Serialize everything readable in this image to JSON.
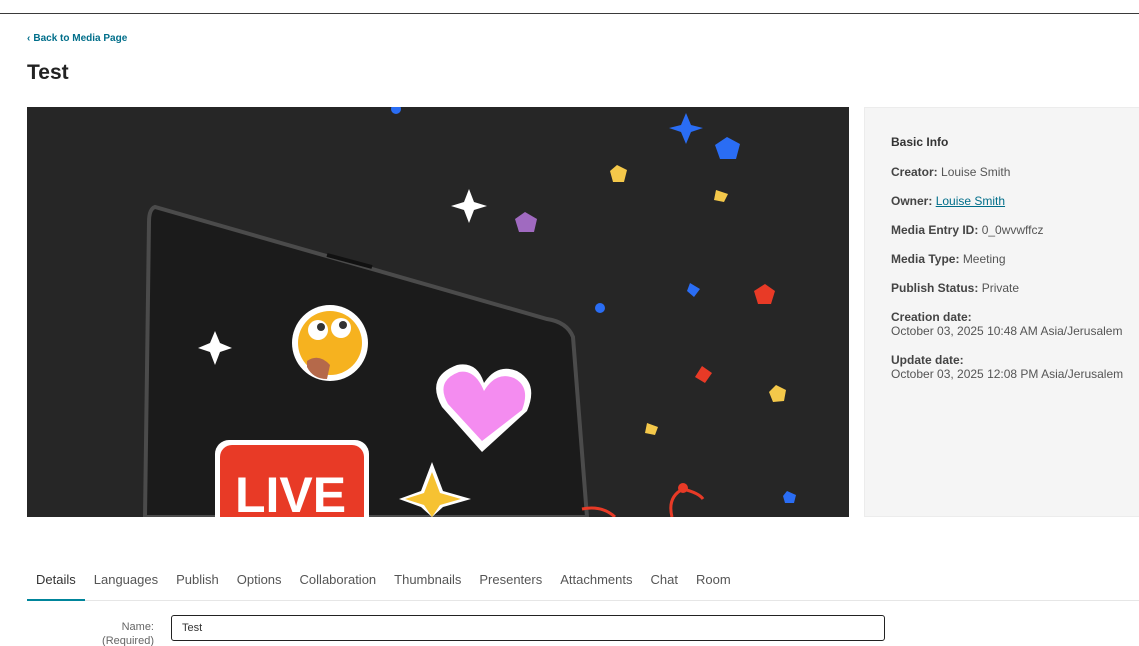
{
  "nav": {
    "back_label": "Back to Media Page"
  },
  "page": {
    "title": "Test"
  },
  "media": {
    "overlay_text": "LIVE"
  },
  "info": {
    "heading": "Basic Info",
    "creator_key": "Creator:",
    "creator_val": "Louise Smith",
    "owner_key": "Owner:",
    "owner_val": "Louise Smith",
    "entry_key": "Media Entry ID:",
    "entry_val": "0_0wvwffcz",
    "type_key": "Media Type:",
    "type_val": "Meeting",
    "status_key": "Publish Status:",
    "status_val": "Private",
    "created_key": "Creation date:",
    "created_val": "October 03, 2025 10:48 AM Asia/Jerusalem",
    "updated_key": "Update date:",
    "updated_val": "October 03, 2025 12:08 PM Asia/Jerusalem"
  },
  "tabs": [
    {
      "label": "Details"
    },
    {
      "label": "Languages"
    },
    {
      "label": "Publish"
    },
    {
      "label": "Options"
    },
    {
      "label": "Collaboration"
    },
    {
      "label": "Thumbnails"
    },
    {
      "label": "Presenters"
    },
    {
      "label": "Attachments"
    },
    {
      "label": "Chat"
    },
    {
      "label": "Room"
    }
  ],
  "form": {
    "name_label": "Name:",
    "required_label": "(Required)",
    "name_value": "Test"
  },
  "colors": {
    "accent": "#00859b",
    "link": "#006e8a",
    "live_red": "#e83a26"
  }
}
